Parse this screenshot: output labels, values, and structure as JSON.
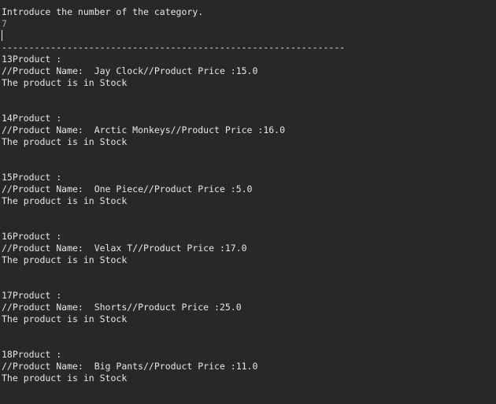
{
  "console": {
    "prompt": "Introduce the number of the category.",
    "input_value": "7",
    "separator": "---------------------------------------------------------------",
    "products": [
      {
        "header": "13Product :",
        "detail": "//Product Name:  Jay Clock//Product Price :15.0",
        "stock": "The product is in Stock"
      },
      {
        "header": "14Product :",
        "detail": "//Product Name:  Arctic Monkeys//Product Price :16.0",
        "stock": "The product is in Stock"
      },
      {
        "header": "15Product :",
        "detail": "//Product Name:  One Piece//Product Price :5.0",
        "stock": "The product is in Stock"
      },
      {
        "header": "16Product :",
        "detail": "//Product Name:  Velax T//Product Price :17.0",
        "stock": "The product is in Stock"
      },
      {
        "header": "17Product :",
        "detail": "//Product Name:  Shorts//Product Price :25.0",
        "stock": "The product is in Stock"
      },
      {
        "header": "18Product :",
        "detail": "//Product Name:  Big Pants//Product Price :11.0",
        "stock": "The product is in Stock"
      }
    ]
  }
}
